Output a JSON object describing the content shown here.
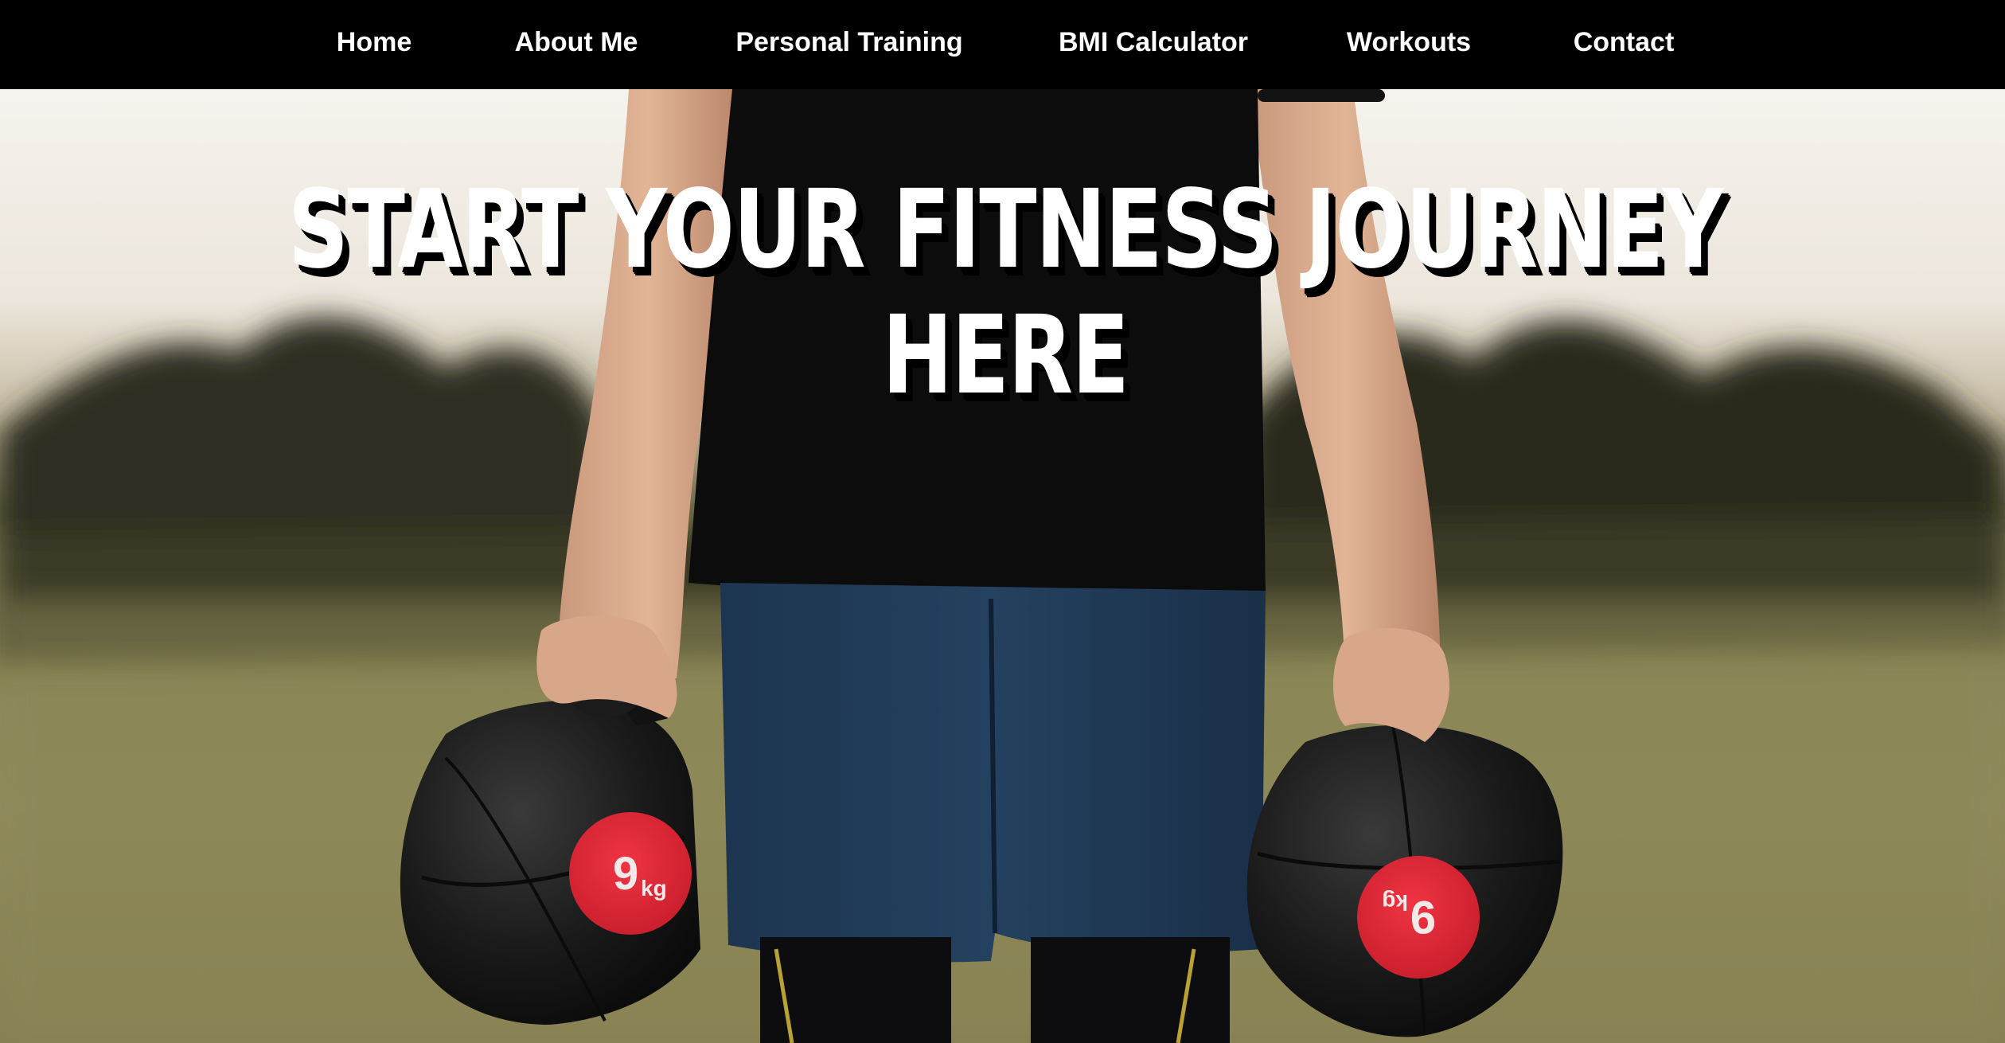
{
  "nav": {
    "items": [
      {
        "id": "home",
        "label": "Home"
      },
      {
        "id": "about",
        "label": "About Me"
      },
      {
        "id": "personal-training",
        "label": "Personal Training"
      },
      {
        "id": "bmi",
        "label": "BMI Calculator"
      },
      {
        "id": "workouts",
        "label": "Workouts"
      },
      {
        "id": "contact",
        "label": "Contact"
      }
    ]
  },
  "hero": {
    "title": "START YOUR FITNESS JOURNEY HERE",
    "left_weight": {
      "number": "9",
      "unit": "kg"
    },
    "right_weight": {
      "number": "9",
      "unit": "kg"
    }
  },
  "colors": {
    "nav_bg": "#000000",
    "nav_text": "#ffffff",
    "weight_badge": "#e02736"
  }
}
